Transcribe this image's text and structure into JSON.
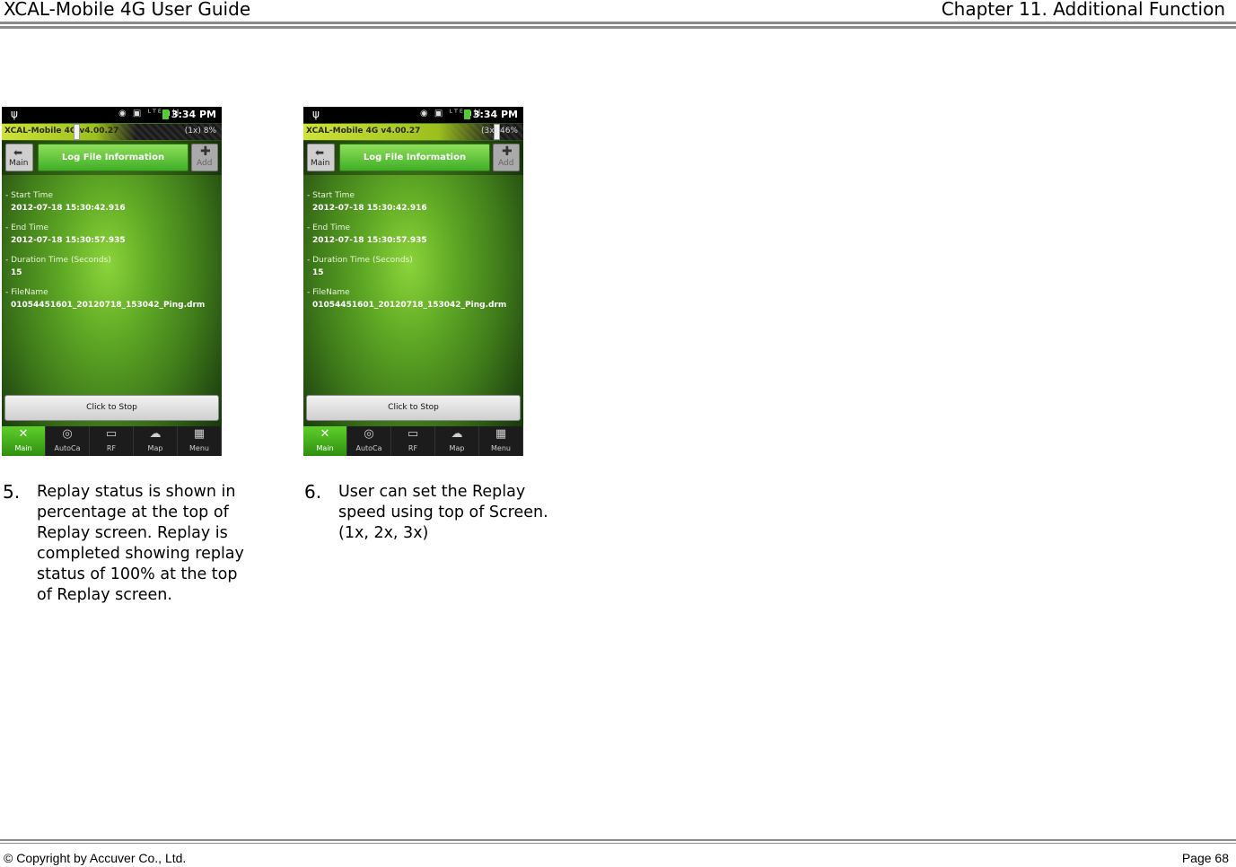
{
  "header": {
    "left": "XCAL-Mobile 4G User Guide",
    "right": "Chapter 11. Additional Function"
  },
  "footer": {
    "left": "© Copyright by Accuver Co., Ltd.",
    "right": "Page 68"
  },
  "phone_common": {
    "status_time": "3:34 PM",
    "status_icons": "◉ ▣ ᴸᵀᴱ ıll",
    "usb_icon": "ψ",
    "app_title": "XCAL-Mobile 4G v4.00.27",
    "main_button": "Main",
    "log_button": "Log File Information",
    "add_button": "Add",
    "start_label": "- Start Time",
    "start_value": "2012-07-18 15:30:42.916",
    "end_label": "- End Time",
    "end_value": "2012-07-18 15:30:57.935",
    "duration_label": "- Duration Time (Seconds)",
    "duration_value": "15",
    "filename_label": "- FileName",
    "filename_value": "01054451601_20120718_153042_Ping.drm",
    "stop_button": "Click to Stop",
    "nav": [
      "Main",
      "AutoCa",
      "RF",
      "Map",
      "Menu"
    ]
  },
  "screenshot1": {
    "speed": "(1x) 8%"
  },
  "screenshot2": {
    "speed": "(3x) 46%"
  },
  "captions": [
    {
      "num": "5.",
      "text": "Replay status is shown in percentage at the top of Replay screen. Replay is completed showing replay status of 100% at the top of Replay screen."
    },
    {
      "num": "6.",
      "text": "User can set the Replay speed using top of Screen. (1x, 2x, 3x)"
    }
  ]
}
